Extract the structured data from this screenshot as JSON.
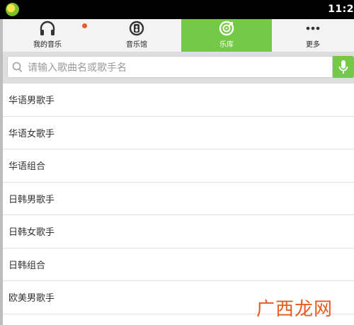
{
  "status_bar": {
    "time": "11:2"
  },
  "tabs": [
    {
      "label": "我的音乐",
      "icon": "headphones-icon",
      "active": false,
      "has_notification_dot": true
    },
    {
      "label": "音乐馆",
      "icon": "music-hall-icon",
      "active": false
    },
    {
      "label": "乐库",
      "icon": "music-library-icon",
      "active": true
    },
    {
      "label": "更多",
      "icon": "more-dots-icon",
      "active": false
    }
  ],
  "search": {
    "placeholder": "请输入歌曲名或歌手名",
    "value": ""
  },
  "categories": [
    "华语男歌手",
    "华语女歌手",
    "华语组合",
    "日韩男歌手",
    "日韩女歌手",
    "日韩组合",
    "欧美男歌手"
  ],
  "watermark": {
    "text": "广西龙网"
  },
  "colors": {
    "accent": "#74c946",
    "notification_dot": "#f05a28",
    "watermark": "#e65a20"
  }
}
